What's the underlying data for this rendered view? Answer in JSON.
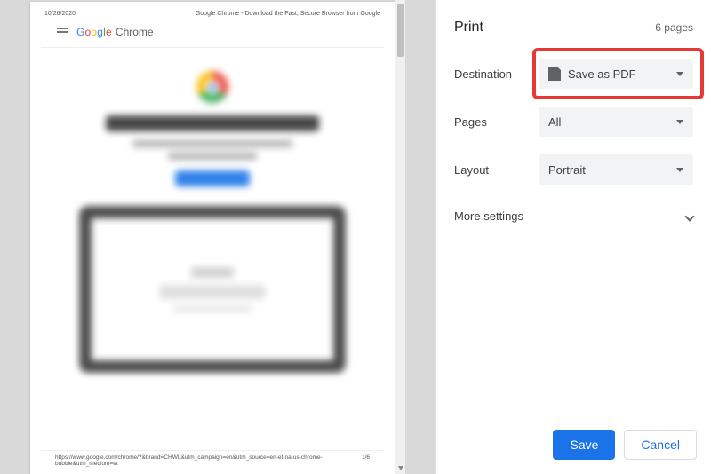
{
  "preview": {
    "date": "10/26/2020",
    "doc_title": "Google Chrome - Download the Fast, Secure Browser from Google",
    "brand_word": "Google",
    "brand_product": "Chrome",
    "footer_url": "https://www.google.com/chrome/?&brand=CHWL&utm_campaign=en&utm_source=en-et-na-us-chrome-bubble&utm_medium=et",
    "footer_pagenum": "1/6"
  },
  "sidebar": {
    "title": "Print",
    "page_count": "6 pages",
    "rows": {
      "destination": {
        "label": "Destination",
        "value": "Save as PDF"
      },
      "pages": {
        "label": "Pages",
        "value": "All"
      },
      "layout": {
        "label": "Layout",
        "value": "Portrait"
      }
    },
    "more_settings": "More settings",
    "actions": {
      "save": "Save",
      "cancel": "Cancel"
    }
  }
}
